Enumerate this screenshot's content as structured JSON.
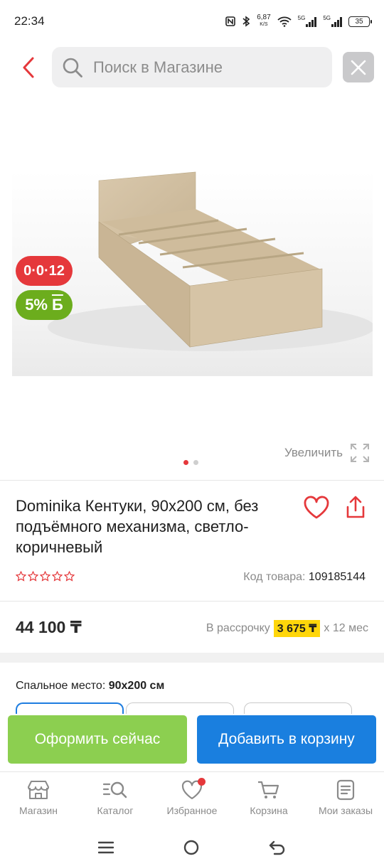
{
  "status_bar": {
    "time": "22:34",
    "speed_value": "6,87",
    "speed_unit": "K/S",
    "net1": "5G",
    "net2": "5G",
    "battery": "35"
  },
  "header": {
    "search_placeholder": "Поиск в Магазине"
  },
  "gallery": {
    "badge_installment": "0·0·12",
    "badge_bonus": "5%",
    "badge_bonus_symbol": "Б",
    "zoom_label": "Увеличить",
    "slide_count": 2,
    "active_slide": 1
  },
  "product": {
    "title": "Dominika Кентуки, 90х200 см, без подъёмного механизма, светло-коричневый",
    "rating_stars": 0,
    "code_label": "Код товара:",
    "code_value": "109185144",
    "price": "44 100 ₸",
    "installment_prefix": "В рассрочку",
    "installment_amount": "3 675 ₸",
    "installment_suffix": "х 12 мес",
    "option_label": "Спальное место:",
    "option_value": "90х200 см"
  },
  "actions": {
    "buy_now": "Оформить сейчас",
    "add_to_cart": "Добавить в корзину"
  },
  "nav": {
    "items": [
      {
        "label": "Магазин",
        "icon": "store-icon"
      },
      {
        "label": "Каталог",
        "icon": "catalog-search-icon"
      },
      {
        "label": "Избранное",
        "icon": "heart-icon"
      },
      {
        "label": "Корзина",
        "icon": "cart-icon"
      },
      {
        "label": "Мои заказы",
        "icon": "orders-icon"
      }
    ]
  },
  "colors": {
    "accent_red": "#e5383b",
    "bonus_green": "#6cad1d",
    "buy_green": "#8ccf50",
    "cart_blue": "#1a7fdf",
    "installment_yellow": "#ffd60a"
  }
}
